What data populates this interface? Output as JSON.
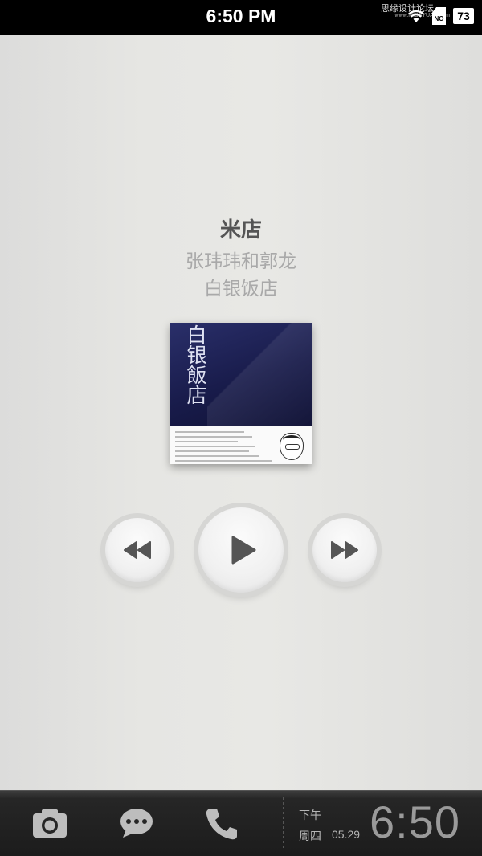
{
  "status_bar": {
    "time": "6:50 PM",
    "battery": "73",
    "sim": "NO",
    "watermark": "思缘设计论坛",
    "watermark_sub": "www.MISSYUAN.com",
    "icons": [
      "wifi-icon",
      "sim-icon",
      "battery-icon"
    ]
  },
  "track": {
    "title": "米店",
    "artist": "张玮玮和郭龙",
    "album": "白银饭店"
  },
  "album_cover": {
    "title_text": "白银飯店",
    "colors": {
      "top": "#181b4a",
      "bottom": "#fafafa"
    }
  },
  "controls": {
    "previous": "rewind-icon",
    "play": "play-icon",
    "next": "fast-forward-icon"
  },
  "dock": {
    "apps": [
      "camera-icon",
      "messages-icon",
      "phone-icon"
    ],
    "ampm": "下午",
    "weekday": "周四",
    "date": "05.29",
    "clock": "6:50"
  },
  "colors": {
    "background": "#e4e4e1",
    "title": "#555555",
    "subtitle": "#a9a9a9",
    "icon": "#555555",
    "dock": "#1c1c1c"
  }
}
